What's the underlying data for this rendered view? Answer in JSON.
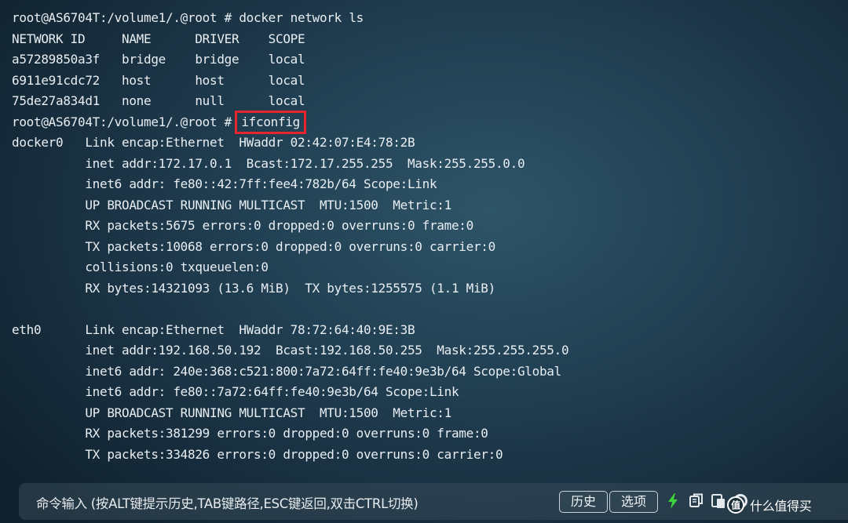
{
  "terminal": {
    "lines": [
      "root@AS6704T:/volume1/.@root # docker network ls",
      "NETWORK ID     NAME      DRIVER    SCOPE",
      "a57289850a3f   bridge    bridge    local",
      "6911e91cdc72   host      host      local",
      "75de27a834d1   none      null      local",
      "root@AS6704T:/volume1/.@root # ",
      "docker0   Link encap:Ethernet  HWaddr 02:42:07:E4:78:2B",
      "          inet addr:172.17.0.1  Bcast:172.17.255.255  Mask:255.255.0.0",
      "          inet6 addr: fe80::42:7ff:fee4:782b/64 Scope:Link",
      "          UP BROADCAST RUNNING MULTICAST  MTU:1500  Metric:1",
      "          RX packets:5675 errors:0 dropped:0 overruns:0 frame:0",
      "          TX packets:10068 errors:0 dropped:0 overruns:0 carrier:0",
      "          collisions:0 txqueuelen:0",
      "          RX bytes:14321093 (13.6 MiB)  TX bytes:1255575 (1.1 MiB)",
      "",
      "eth0      Link encap:Ethernet  HWaddr 78:72:64:40:9E:3B",
      "          inet addr:192.168.50.192  Bcast:192.168.50.255  Mask:255.255.255.0",
      "          inet6 addr: 240e:368:c521:800:7a72:64ff:fe40:9e3b/64 Scope:Global",
      "          inet6 addr: fe80::7a72:64ff:fe40:9e3b/64 Scope:Link",
      "          UP BROADCAST RUNNING MULTICAST  MTU:1500  Metric:1",
      "          RX packets:381299 errors:0 dropped:0 overruns:0 frame:0",
      "          TX packets:334826 errors:0 dropped:0 overruns:0 carrier:0"
    ],
    "highlighted_command": "ifconfig"
  },
  "bottom_bar": {
    "command_hint": "命令输入 (按ALT键提示历史,TAB键路径,ESC键返回,双击CTRL切换)",
    "history_button": "历史",
    "options_button": "选项"
  },
  "watermark": {
    "text": "什么值得买"
  },
  "colors": {
    "highlight_box": "#e8242c",
    "bolt": "#3fd23f",
    "text": "#e8eef2"
  },
  "icons": [
    "lightning-bolt-icon",
    "copy-icon",
    "paste-icon",
    "settings-icon"
  ]
}
